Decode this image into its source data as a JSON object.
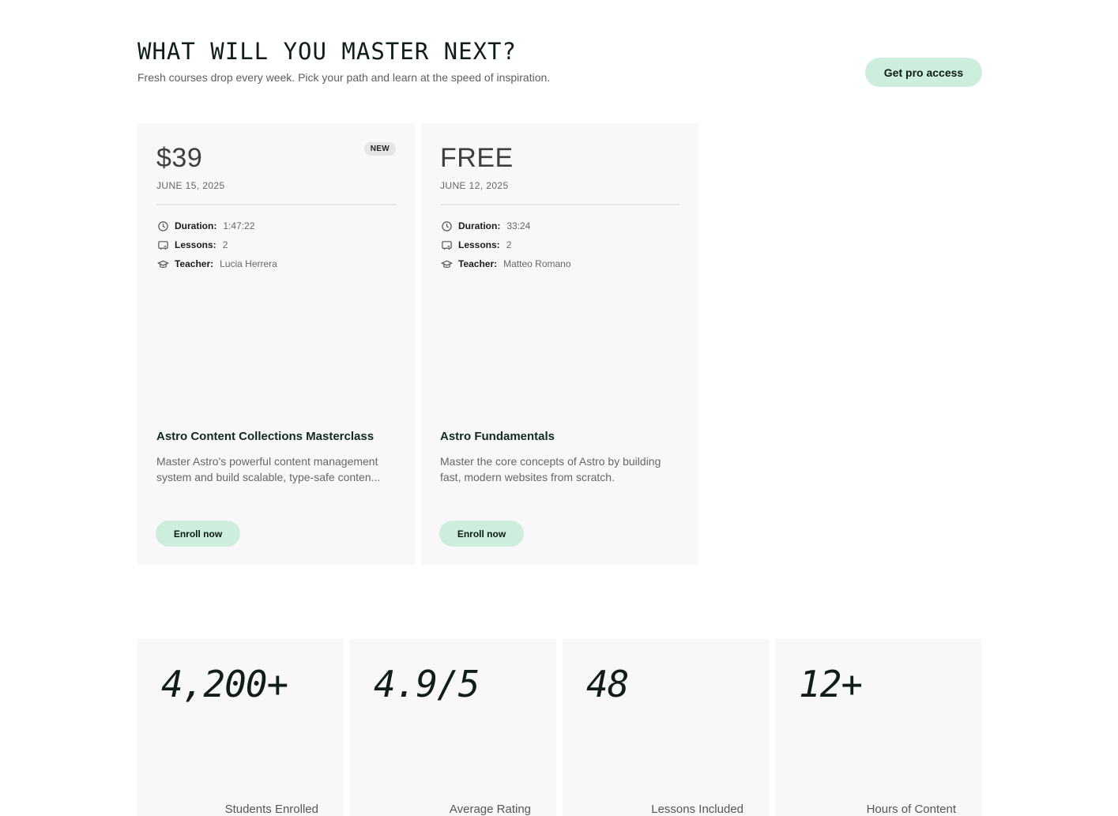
{
  "header": {
    "title": "WHAT WILL YOU MASTER NEXT?",
    "subtitle": "Fresh courses drop every week. Pick your path and learn at the speed of inspiration.",
    "pro_button_label": "Get pro access"
  },
  "courses": [
    {
      "price": "$39",
      "badge": "NEW",
      "date": "JUNE 15, 2025",
      "duration_label": "Duration:",
      "duration": "1:47:22",
      "lessons_label": "Lessons:",
      "lessons": "2",
      "teacher_label": "Teacher:",
      "teacher": "Lucia Herrera",
      "title": "Astro Content Collections Masterclass",
      "description": "Master Astro's powerful content management system and build scalable, type-safe conten...",
      "enroll_label": "Enroll now"
    },
    {
      "price": "FREE",
      "date": "JUNE 12, 2025",
      "duration_label": "Duration:",
      "duration": "33:24",
      "lessons_label": "Lessons:",
      "lessons": "2",
      "teacher_label": "Teacher:",
      "teacher": "Matteo Romano",
      "title": "Astro Fundamentals",
      "description": "Master the core concepts of Astro by building fast, modern websites from scratch.",
      "enroll_label": "Enroll now"
    }
  ],
  "stats": [
    {
      "value": "4,200+",
      "label": "Students Enrolled"
    },
    {
      "value": "4.9/5",
      "label": "Average Rating"
    },
    {
      "value": "48",
      "label": "Lessons Included"
    },
    {
      "value": "12+",
      "label": "Hours of Content"
    }
  ],
  "colors": {
    "accent": "#cdeedd",
    "card_bg": "#f8f8f8",
    "heading": "#0f1e16"
  },
  "icons": {
    "duration": "clock-icon",
    "lessons": "screen-icon",
    "teacher": "graduation-cap-icon"
  }
}
